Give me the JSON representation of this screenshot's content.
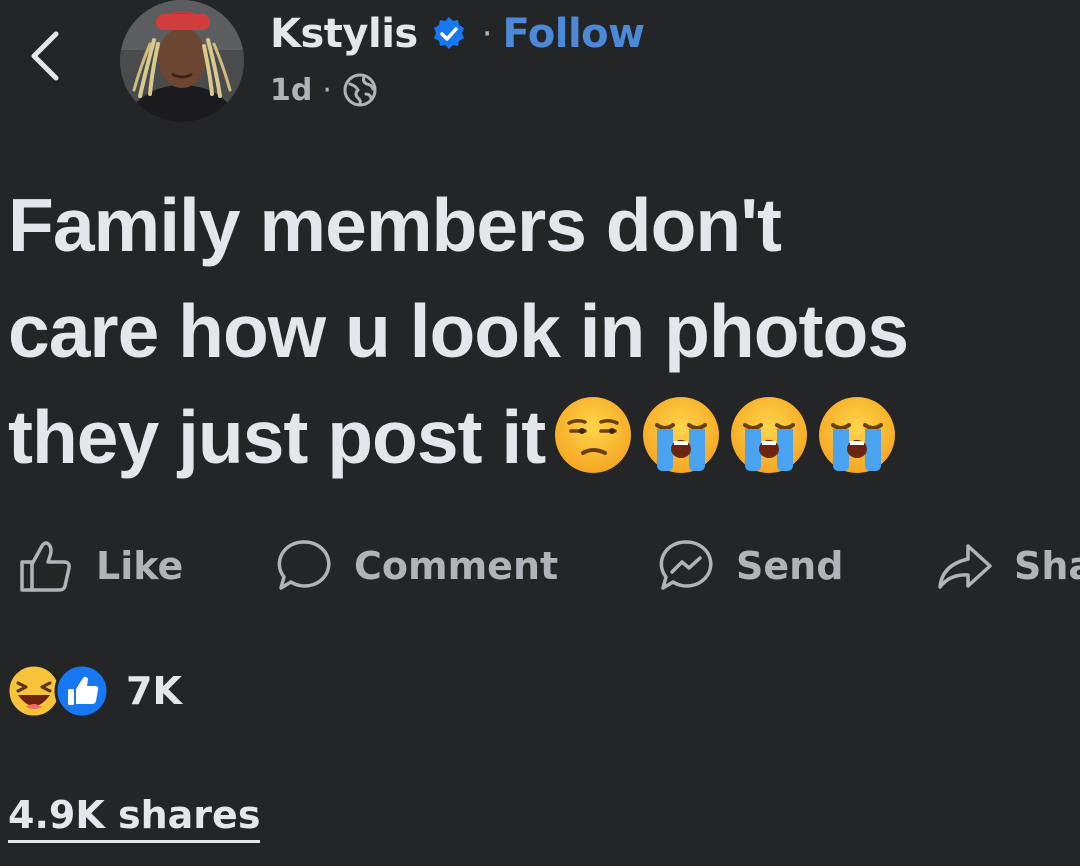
{
  "header": {
    "back_icon": "chevron-left-icon",
    "author_name": "Kstylis",
    "verified_icon": "verified-badge-icon",
    "separator": "·",
    "follow_label": "Follow",
    "time": "1d",
    "meta_separator": "·",
    "privacy_icon": "globe-icon"
  },
  "post": {
    "lines": [
      "Family members don't",
      "care how u look in photos",
      "they just post it"
    ],
    "emojis": [
      "unamused-face",
      "loudly-crying-face",
      "loudly-crying-face",
      "loudly-crying-face"
    ]
  },
  "actions": [
    {
      "label": "Like",
      "icon": "thumbs-up-outline-icon"
    },
    {
      "label": "Comment",
      "icon": "speech-bubble-icon"
    },
    {
      "label": "Send",
      "icon": "messenger-icon"
    },
    {
      "label": "Sha",
      "icon": "share-arrow-icon"
    }
  ],
  "reactions": {
    "icons": [
      "haha-reaction-icon",
      "like-reaction-icon"
    ],
    "count": "7K"
  },
  "shares_label": "4.9K shares",
  "colors": {
    "background": "#242526",
    "text": "#e4e6eb",
    "secondary": "#b0b3b8",
    "accent": "#4a8ad8",
    "verified": "#1877f2"
  }
}
